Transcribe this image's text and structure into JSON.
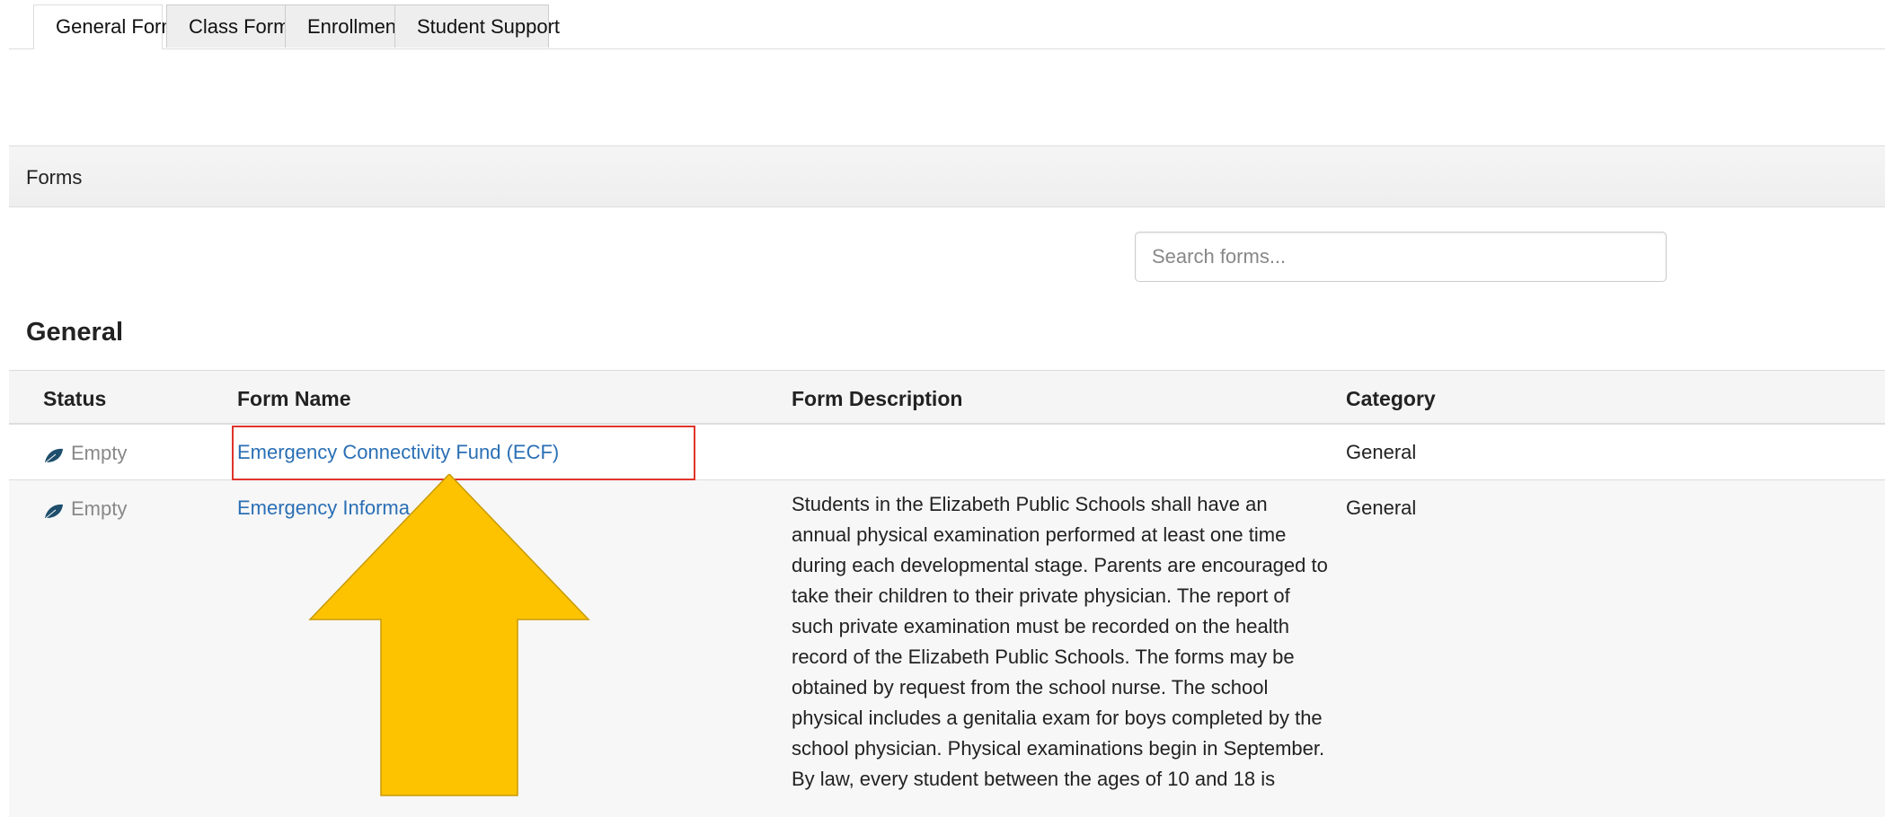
{
  "tabs": [
    {
      "label": "General Forms",
      "active": true
    },
    {
      "label": "Class Forms",
      "active": false
    },
    {
      "label": "Enrollment",
      "active": false
    },
    {
      "label": "Student Support",
      "active": false
    }
  ],
  "panel": {
    "title": "Forms"
  },
  "search": {
    "placeholder": "Search forms..."
  },
  "section": {
    "title": "General"
  },
  "table": {
    "headers": {
      "status": "Status",
      "form_name": "Form Name",
      "form_description": "Form Description",
      "category": "Category"
    },
    "rows": [
      {
        "status": "Empty",
        "form_name": "Emergency Connectivity Fund (ECF)",
        "form_description": "",
        "category": "General"
      },
      {
        "status": "Empty",
        "form_name": "Emergency Informa",
        "form_description": "Students in the Elizabeth Public Schools shall have an annual physical examination performed at least one time during each developmental stage. Parents are encouraged to take their children to their private physician. The report of such private examination must be recorded on the health record of the Elizabeth Public Schools. The forms may be obtained by request from the school nurse. The school physical includes a genitalia exam for boys completed by the school physician. Physical examinations begin in September. By law, every student between the ages of 10 and 18 is",
        "category": "General"
      }
    ]
  },
  "colors": {
    "link": "#2a6fb5",
    "highlight_border": "#e0342b",
    "arrow_fill": "#fdc300",
    "leaf_icon": "#1e4e6c"
  },
  "icons": {
    "status": "leaf-icon",
    "annotation": "up-arrow-icon"
  }
}
